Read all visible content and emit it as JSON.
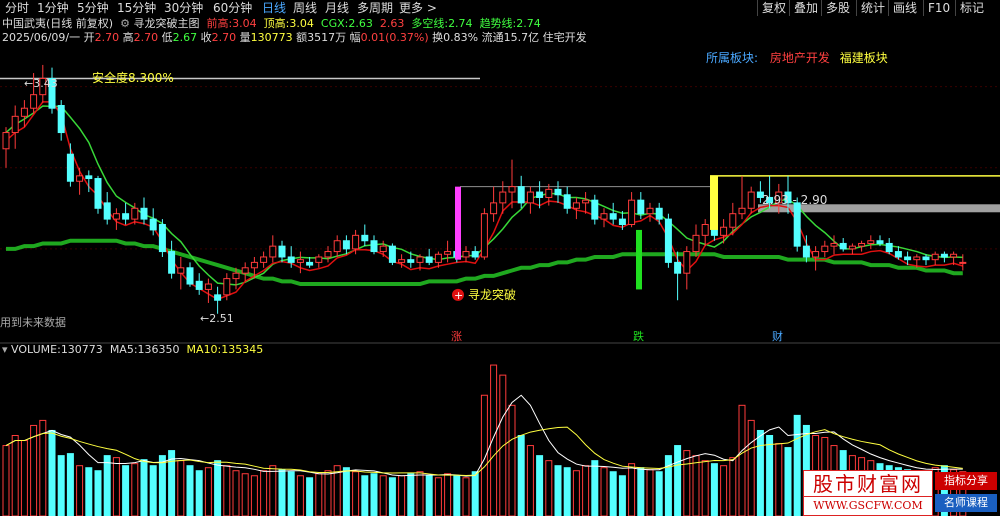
{
  "toolbar": {
    "periods": [
      "分时",
      "1分钟",
      "5分钟",
      "15分钟",
      "30分钟",
      "60分钟",
      "日线",
      "周线",
      "月线",
      "多周期",
      "更多 >"
    ],
    "active_period": "日线",
    "tools": [
      "复权",
      "叠加",
      "多股",
      "统计",
      "画线",
      "F10",
      "标记"
    ]
  },
  "header": {
    "stock": "中国武夷(日线 前复权)",
    "indicator": "寻龙突破主图",
    "qianGao_label": "前高:",
    "qianGao": "3.04",
    "dingGao_label": "顶高:",
    "dingGao": "3.04",
    "cgx_label": "CGX:",
    "cgx": "2.63",
    "v4": "2.63",
    "duokong_label": "多空线:",
    "duokong": "2.74",
    "qushi_label": "趋势线:",
    "qushi": "2.74"
  },
  "quote": {
    "date": "2025/06/09/一",
    "open_label": "开",
    "open": "2.70",
    "high_label": "高",
    "high": "2.70",
    "low_label": "低",
    "low": "2.67",
    "close_label": "收",
    "close": "2.70",
    "vol_label": "量",
    "vol": "130773",
    "amount_label": "额",
    "amount": "3517万",
    "chg_label": "幅",
    "chg": "0.01(0.37%)",
    "turnover_label": "换",
    "turnover": "0.83%",
    "float_label": "流通",
    "float": "15.7亿",
    "sector": "住宅开发"
  },
  "sectors": {
    "label": "所属板块:",
    "s1": "房地产开发",
    "s2": "福建板块"
  },
  "annotations": {
    "high_mark": "3.43",
    "low_mark": "2.51",
    "safety": "安全度8.300%",
    "range": "2.93 - 2.90",
    "breakout": "寻龙突破",
    "future": "用到未来数据",
    "tag_zhang": "涨",
    "tag_die": "跌",
    "tag_cai": "财"
  },
  "volume_header": {
    "vol_label": "VOLUME:",
    "vol": "130773",
    "ma5_label": "MA5:",
    "ma5": "136350",
    "ma10_label": "MA10:",
    "ma10": "135345"
  },
  "watermark": {
    "site": "股市财富网",
    "url": "WWW.GSCFW.COM",
    "tag1": "指标分享",
    "tag2": "名师课程"
  },
  "colors": {
    "up": "#ff3b3b",
    "down": "#54ffff",
    "ma_green": "#1fa81f",
    "ma_red": "#e01010",
    "ma_light_green": "#38d838",
    "yellow": "#ffff40",
    "magenta": "#ff40ff",
    "grey": "#b0b0b0"
  },
  "chart_data": {
    "type": "candlestick",
    "candles": [
      [
        3.12,
        3.2,
        3.05,
        3.18
      ],
      [
        3.18,
        3.28,
        3.12,
        3.24
      ],
      [
        3.24,
        3.3,
        3.2,
        3.27
      ],
      [
        3.27,
        3.4,
        3.25,
        3.32
      ],
      [
        3.32,
        3.43,
        3.29,
        3.38
      ],
      [
        3.38,
        3.42,
        3.25,
        3.27
      ],
      [
        3.28,
        3.3,
        3.15,
        3.18
      ],
      [
        3.1,
        3.14,
        2.98,
        3.0
      ],
      [
        3.0,
        3.05,
        2.95,
        3.02
      ],
      [
        3.02,
        3.04,
        2.96,
        3.01
      ],
      [
        3.01,
        3.02,
        2.88,
        2.9
      ],
      [
        2.92,
        2.96,
        2.84,
        2.86
      ],
      [
        2.86,
        2.9,
        2.82,
        2.88
      ],
      [
        2.88,
        2.92,
        2.84,
        2.86
      ],
      [
        2.86,
        2.92,
        2.84,
        2.9
      ],
      [
        2.9,
        2.94,
        2.84,
        2.86
      ],
      [
        2.86,
        2.9,
        2.8,
        2.82
      ],
      [
        2.84,
        2.86,
        2.72,
        2.74
      ],
      [
        2.74,
        2.78,
        2.64,
        2.66
      ],
      [
        2.66,
        2.72,
        2.6,
        2.68
      ],
      [
        2.68,
        2.7,
        2.61,
        2.62
      ],
      [
        2.63,
        2.66,
        2.58,
        2.6
      ],
      [
        2.6,
        2.64,
        2.55,
        2.62
      ],
      [
        2.58,
        2.61,
        2.51,
        2.56
      ],
      [
        2.58,
        2.66,
        2.56,
        2.64
      ],
      [
        2.64,
        2.68,
        2.6,
        2.66
      ],
      [
        2.66,
        2.7,
        2.63,
        2.68
      ],
      [
        2.68,
        2.72,
        2.64,
        2.7
      ],
      [
        2.7,
        2.74,
        2.68,
        2.72
      ],
      [
        2.72,
        2.8,
        2.7,
        2.76
      ],
      [
        2.76,
        2.78,
        2.7,
        2.72
      ],
      [
        2.72,
        2.76,
        2.68,
        2.7
      ],
      [
        2.7,
        2.74,
        2.66,
        2.71
      ],
      [
        2.7,
        2.72,
        2.68,
        2.69
      ],
      [
        2.7,
        2.73,
        2.68,
        2.72
      ],
      [
        2.72,
        2.76,
        2.7,
        2.74
      ],
      [
        2.74,
        2.8,
        2.72,
        2.78
      ],
      [
        2.78,
        2.8,
        2.73,
        2.75
      ],
      [
        2.75,
        2.82,
        2.73,
        2.8
      ],
      [
        2.8,
        2.84,
        2.76,
        2.78
      ],
      [
        2.78,
        2.8,
        2.73,
        2.74
      ],
      [
        2.74,
        2.78,
        2.72,
        2.76
      ],
      [
        2.76,
        2.77,
        2.69,
        2.7
      ],
      [
        2.7,
        2.73,
        2.68,
        2.71
      ],
      [
        2.71,
        2.74,
        2.68,
        2.7
      ],
      [
        2.7,
        2.73,
        2.67,
        2.72
      ],
      [
        2.72,
        2.75,
        2.69,
        2.7
      ],
      [
        2.7,
        2.74,
        2.68,
        2.73
      ],
      [
        2.73,
        2.78,
        2.7,
        2.74
      ],
      [
        2.74,
        2.76,
        2.7,
        2.72
      ],
      [
        2.72,
        2.76,
        2.7,
        2.74
      ],
      [
        2.74,
        2.76,
        2.71,
        2.72
      ],
      [
        2.72,
        2.9,
        2.71,
        2.88
      ],
      [
        2.88,
        2.98,
        2.85,
        2.92
      ],
      [
        2.92,
        3.0,
        2.88,
        2.96
      ],
      [
        2.96,
        3.08,
        2.9,
        2.98
      ],
      [
        2.98,
        3.02,
        2.9,
        2.92
      ],
      [
        2.92,
        2.98,
        2.88,
        2.96
      ],
      [
        2.96,
        3.0,
        2.9,
        2.94
      ],
      [
        2.94,
        2.99,
        2.91,
        2.97
      ],
      [
        2.97,
        3.0,
        2.92,
        2.95
      ],
      [
        2.95,
        2.98,
        2.88,
        2.9
      ],
      [
        2.9,
        2.94,
        2.86,
        2.92
      ],
      [
        2.92,
        2.96,
        2.88,
        2.93
      ],
      [
        2.93,
        2.95,
        2.84,
        2.86
      ],
      [
        2.86,
        2.9,
        2.83,
        2.88
      ],
      [
        2.88,
        2.92,
        2.84,
        2.86
      ],
      [
        2.86,
        2.89,
        2.82,
        2.84
      ],
      [
        2.84,
        2.96,
        2.83,
        2.93
      ],
      [
        2.93,
        2.96,
        2.86,
        2.88
      ],
      [
        2.88,
        2.92,
        2.85,
        2.9
      ],
      [
        2.9,
        2.92,
        2.84,
        2.86
      ],
      [
        2.86,
        2.88,
        2.68,
        2.7
      ],
      [
        2.7,
        2.74,
        2.56,
        2.66
      ],
      [
        2.66,
        2.76,
        2.6,
        2.74
      ],
      [
        2.74,
        2.84,
        2.72,
        2.8
      ],
      [
        2.8,
        2.86,
        2.76,
        2.84
      ],
      [
        2.84,
        2.88,
        2.78,
        2.8
      ],
      [
        2.8,
        2.86,
        2.77,
        2.83
      ],
      [
        2.83,
        2.92,
        2.8,
        2.88
      ],
      [
        2.88,
        3.02,
        2.86,
        2.9
      ],
      [
        2.9,
        2.98,
        2.88,
        2.96
      ],
      [
        2.96,
        3.0,
        2.92,
        2.94
      ],
      [
        2.94,
        3.02,
        2.9,
        2.92
      ],
      [
        2.92,
        2.99,
        2.88,
        2.96
      ],
      [
        2.96,
        3.02,
        2.88,
        2.92
      ],
      [
        2.92,
        2.94,
        2.74,
        2.76
      ],
      [
        2.76,
        2.8,
        2.7,
        2.72
      ],
      [
        2.72,
        2.76,
        2.67,
        2.74
      ],
      [
        2.74,
        2.78,
        2.72,
        2.76
      ],
      [
        2.76,
        2.8,
        2.73,
        2.77
      ],
      [
        2.77,
        2.79,
        2.74,
        2.75
      ],
      [
        2.75,
        2.77,
        2.73,
        2.76
      ],
      [
        2.76,
        2.78,
        2.74,
        2.77
      ],
      [
        2.77,
        2.8,
        2.75,
        2.78
      ],
      [
        2.78,
        2.8,
        2.76,
        2.77
      ],
      [
        2.77,
        2.79,
        2.73,
        2.74
      ],
      [
        2.74,
        2.76,
        2.71,
        2.72
      ],
      [
        2.72,
        2.74,
        2.69,
        2.71
      ],
      [
        2.71,
        2.73,
        2.68,
        2.72
      ],
      [
        2.72,
        2.73,
        2.69,
        2.71
      ],
      [
        2.71,
        2.74,
        2.69,
        2.73
      ],
      [
        2.73,
        2.74,
        2.7,
        2.72
      ],
      [
        2.72,
        2.74,
        2.69,
        2.73
      ],
      [
        2.7,
        2.73,
        2.67,
        2.7
      ]
    ],
    "volume": [
      70,
      80,
      75,
      90,
      95,
      85,
      60,
      62,
      50,
      48,
      45,
      60,
      58,
      50,
      52,
      56,
      50,
      60,
      65,
      55,
      50,
      45,
      48,
      55,
      50,
      45,
      42,
      40,
      45,
      50,
      46,
      44,
      40,
      38,
      42,
      45,
      50,
      48,
      44,
      40,
      42,
      40,
      38,
      40,
      42,
      44,
      40,
      38,
      42,
      40,
      38,
      44,
      120,
      150,
      140,
      110,
      80,
      70,
      60,
      55,
      50,
      48,
      45,
      50,
      55,
      48,
      44,
      40,
      52,
      48,
      46,
      44,
      60,
      70,
      65,
      60,
      55,
      52,
      50,
      58,
      110,
      95,
      85,
      80,
      72,
      68,
      100,
      90,
      80,
      78,
      70,
      65,
      60,
      58,
      55,
      52,
      50,
      48,
      46,
      44,
      45,
      48,
      50,
      46,
      44
    ],
    "ma_long": [
      2.75,
      2.75,
      2.76,
      2.76,
      2.77,
      2.77,
      2.77,
      2.78,
      2.78,
      2.78,
      2.78,
      2.78,
      2.78,
      2.77,
      2.77,
      2.76,
      2.76,
      2.75,
      2.74,
      2.73,
      2.72,
      2.71,
      2.7,
      2.69,
      2.68,
      2.67,
      2.66,
      2.65,
      2.64,
      2.64,
      2.63,
      2.63,
      2.62,
      2.62,
      2.62,
      2.62,
      2.62,
      2.62,
      2.62,
      2.62,
      2.62,
      2.62,
      2.62,
      2.62,
      2.62,
      2.62,
      2.63,
      2.63,
      2.63,
      2.63,
      2.64,
      2.64,
      2.65,
      2.65,
      2.66,
      2.67,
      2.68,
      2.68,
      2.69,
      2.69,
      2.7,
      2.7,
      2.71,
      2.71,
      2.72,
      2.72,
      2.72,
      2.73,
      2.73,
      2.73,
      2.73,
      2.73,
      2.73,
      2.73,
      2.73,
      2.73,
      2.73,
      2.73,
      2.72,
      2.72,
      2.72,
      2.72,
      2.72,
      2.72,
      2.72,
      2.71,
      2.71,
      2.71,
      2.71,
      2.71,
      2.7,
      2.7,
      2.7,
      2.7,
      2.69,
      2.69,
      2.69,
      2.68,
      2.68,
      2.68,
      2.67,
      2.67,
      2.67,
      2.66,
      2.66
    ]
  }
}
